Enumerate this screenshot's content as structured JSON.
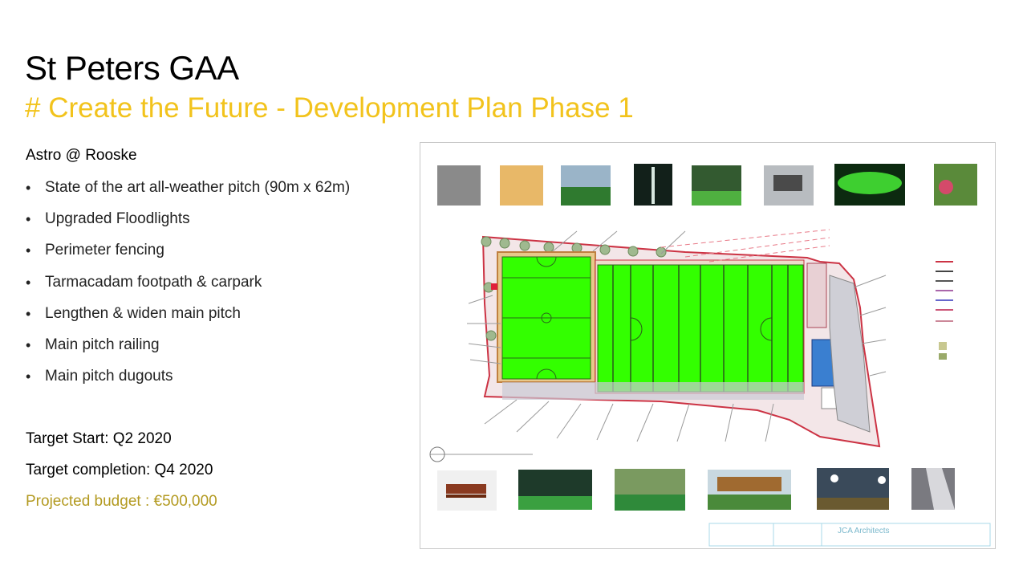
{
  "slide": {
    "title": "St Peters GAA",
    "subtitle": "# Create the Future - Development Plan Phase 1"
  },
  "content": {
    "heading": "Astro @ Rooske",
    "bullets": [
      "State of the art all-weather pitch (90m x 62m)",
      "Upgraded Floodlights",
      "Perimeter fencing",
      "Tarmacadam footpath & carpark",
      "Lengthen & widen main pitch",
      "Main pitch railing",
      "Main pitch dugouts"
    ],
    "target_start": "Target Start: Q2 2020",
    "target_completion": "Target completion: Q4 2020",
    "budget": "Projected budget : €500,000"
  },
  "plan": {
    "architect": "JCA Architects",
    "colors": {
      "pitch_green": "#33ff00",
      "boundary_red": "#cc3344",
      "carpark_blue": "#3a7fd0",
      "accent_yellow": "#f2c31c",
      "budget_gold": "#b39a21"
    }
  }
}
